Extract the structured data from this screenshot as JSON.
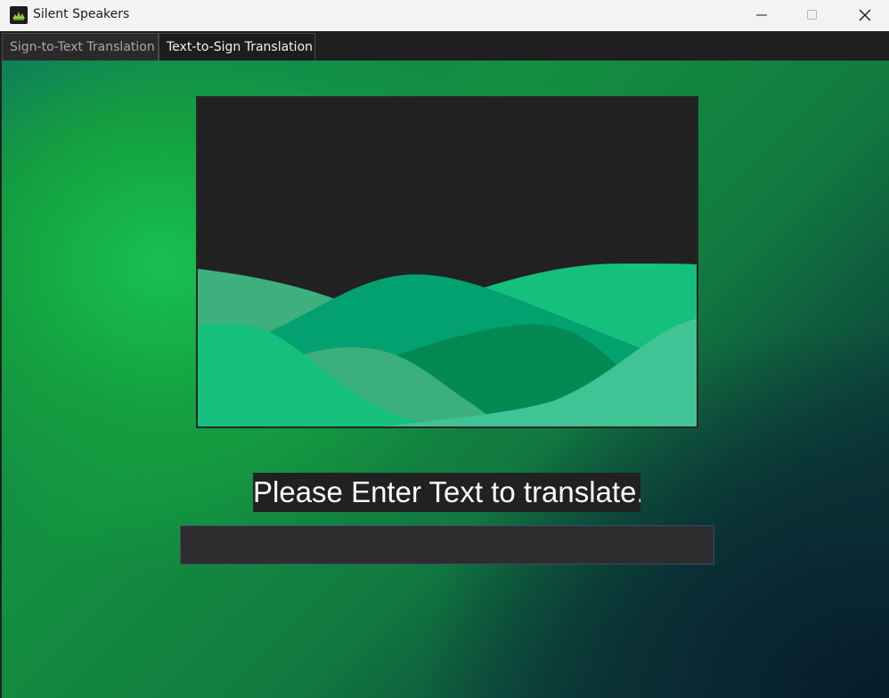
{
  "window": {
    "title": "Silent Speakers",
    "icons": {
      "app": "app-leaf-icon",
      "minimize": "minimize-icon",
      "maximize": "maximize-icon",
      "close": "close-icon"
    }
  },
  "tabs": [
    {
      "label": "Sign-to-Text Translation",
      "active": false
    },
    {
      "label": "Text-to-Sign Translation",
      "active": true
    }
  ],
  "main": {
    "image_placeholder": "landscape-placeholder-image",
    "prompt": "Please Enter Text to translate.",
    "input_value": "",
    "input_placeholder": ""
  },
  "colors": {
    "accent_green": "#13c07a",
    "panel_dark": "#212121",
    "input_bg": "#2d2d2d"
  }
}
